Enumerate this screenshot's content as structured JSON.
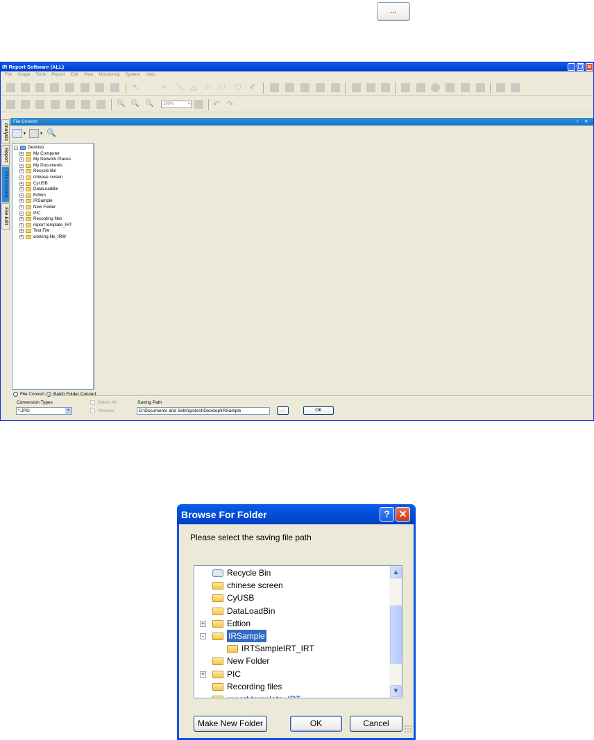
{
  "top_ellipsis": "...",
  "window": {
    "title": "IR Report Software (ALL)",
    "minimize_glyph": "_",
    "restore_glyph": "❐",
    "close_glyph": "✕",
    "menu": [
      "File",
      "Image",
      "Tools",
      "Report",
      "Edit",
      "View",
      "Monitoring",
      "System",
      "Help"
    ],
    "zoom_value": "100%"
  },
  "side_tabs": [
    "Analysis",
    "Report",
    "File Convert",
    "File Edit"
  ],
  "panel": {
    "title": "File Convert",
    "pin_glyph": "⊣",
    "close_glyph": "✕"
  },
  "tree": [
    {
      "label": "Desktop",
      "expander": "-",
      "level": 0
    },
    {
      "label": "My Computer",
      "expander": "+",
      "level": 1
    },
    {
      "label": "My Network Places",
      "expander": "+",
      "level": 1
    },
    {
      "label": "My Documents",
      "expander": "+",
      "level": 1
    },
    {
      "label": "Recycle Bin",
      "expander": "+",
      "level": 1
    },
    {
      "label": "chinese screen",
      "expander": "+",
      "level": 1
    },
    {
      "label": "CyUSB",
      "expander": "+",
      "level": 1
    },
    {
      "label": "DataLoadBin",
      "expander": "+",
      "level": 1
    },
    {
      "label": "Edtion",
      "expander": "+",
      "level": 1
    },
    {
      "label": "IRSample",
      "expander": "+",
      "level": 1
    },
    {
      "label": "New Folder",
      "expander": "+",
      "level": 1
    },
    {
      "label": "PIC",
      "expander": "+",
      "level": 1
    },
    {
      "label": "Recording files",
      "expander": "+",
      "level": 1
    },
    {
      "label": "report template_IRT",
      "expander": "+",
      "level": 1
    },
    {
      "label": "Test File",
      "expander": "+",
      "level": 1
    },
    {
      "label": "working file_IRW",
      "expander": "+",
      "level": 1
    }
  ],
  "convert": {
    "file_convert_label": "File Convert",
    "batch_convert_label": "Batch Folder Convert",
    "conversion_types_label": "Conversion Types",
    "conversion_type_value": "*.JPG",
    "select_all_label": "Select All",
    "reverse_label": "Reverse",
    "saving_path_label": "Saving Path",
    "saving_path_value": "D:\\Documents and Settings\\test\\Desktop\\IRSample",
    "browse_label": "...",
    "ok_label": "OK"
  },
  "dialog": {
    "title": "Browse For Folder",
    "help_glyph": "?",
    "close_glyph": "✕",
    "prompt": "Please select the saving file path",
    "items": [
      {
        "label": "Recycle Bin",
        "expander": ""
      },
      {
        "label": "chinese screen",
        "expander": ""
      },
      {
        "label": "CyUSB",
        "expander": ""
      },
      {
        "label": "DataLoadBin",
        "expander": ""
      },
      {
        "label": "Edtion",
        "expander": "+"
      },
      {
        "label": "IRSample",
        "expander": "-",
        "selected": true
      },
      {
        "label": "IRTSampleIRT_IRT",
        "expander": "",
        "child": true
      },
      {
        "label": "New Folder",
        "expander": ""
      },
      {
        "label": "PIC",
        "expander": "+"
      },
      {
        "label": "Recording files",
        "expander": ""
      },
      {
        "label": "report template_IRT",
        "expander": ""
      }
    ],
    "make_new_folder": "Make New Folder",
    "ok": "OK",
    "cancel": "Cancel",
    "scroll_up": "▲",
    "scroll_down": "▼"
  }
}
